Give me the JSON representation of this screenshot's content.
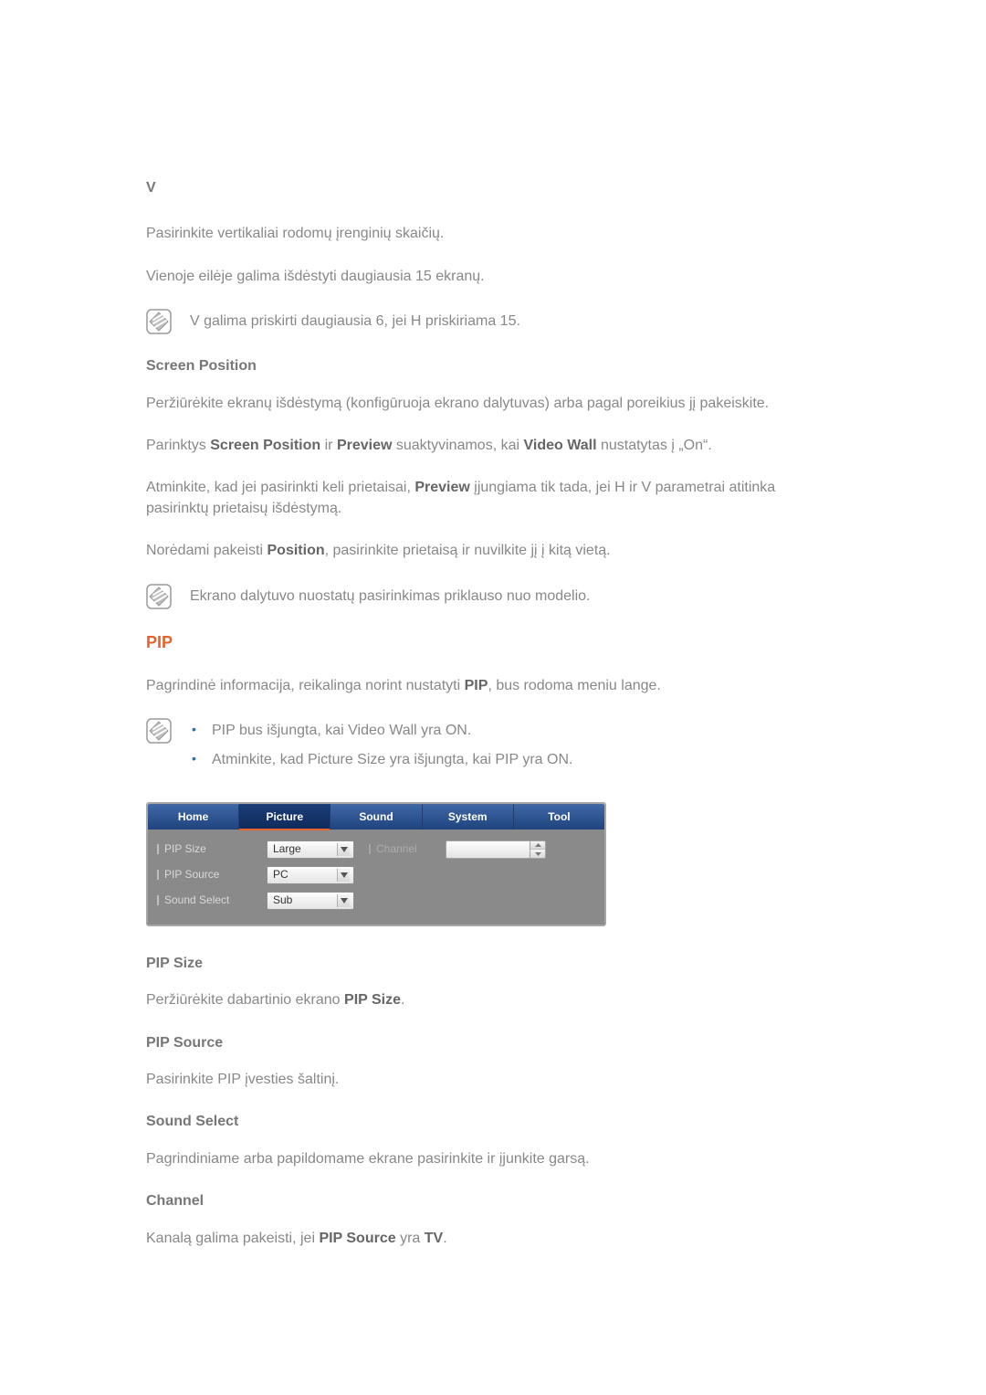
{
  "section_v": {
    "title": "V",
    "p1": "Pasirinkite vertikaliai rodomų įrenginių skaičių.",
    "p2": "Vienoje eilėje galima išdėstyti daugiausia 15 ekranų.",
    "note": "V galima priskirti daugiausia 6, jei H priskiriama 15."
  },
  "screen_position": {
    "title": "Screen Position",
    "p1_pre": "Peržiūrėkite ekranų išdėstymą (konfigūruoja ekrano dalytuvas) arba pagal poreikius jį pakeiskite.",
    "p2_pre": "Parinktys ",
    "p2_b1": "Screen Position",
    "p2_mid1": " ir ",
    "p2_b2": "Preview",
    "p2_mid2": " suaktyvinamos, kai ",
    "p2_b3": "Video Wall",
    "p2_post": " nustatytas į „On“.",
    "p3_pre": "Atminkite, kad jei pasirinkti keli prietaisai, ",
    "p3_b1": "Preview",
    "p3_post": " įjungiama tik tada, jei H ir V parametrai atitinka pasirinktų prietaisų išdėstymą.",
    "p4_pre": "Norėdami pakeisti ",
    "p4_b1": "Position",
    "p4_post": ", pasirinkite prietaisą ir nuvilkite jį į kitą vietą.",
    "note": "Ekrano dalytuvo nuostatų pasirinkimas priklauso nuo modelio."
  },
  "pip": {
    "title": "PIP",
    "intro_pre": "Pagrindinė informacija, reikalinga norint nustatyti ",
    "intro_b": "PIP",
    "intro_post": ", bus rodoma meniu lange.",
    "bullet1_b1": "PIP",
    "bullet1_mid": " bus išjungta, kai ",
    "bullet1_b2": "Video Wall",
    "bullet1_mid2": " yra ",
    "bullet1_b3": "ON",
    "bullet1_post": ".",
    "bullet2_pre": "Atminkite, kad ",
    "bullet2_b1": "Picture Size",
    "bullet2_mid": " yra išjungta, kai ",
    "bullet2_b2": "PIP",
    "bullet2_mid2": " yra ",
    "bullet2_b3": "ON",
    "bullet2_post": "."
  },
  "panel": {
    "tabs": [
      "Home",
      "Picture",
      "Sound",
      "System",
      "Tool"
    ],
    "selected_index": 1,
    "rows": {
      "pip_size_label": "PIP Size",
      "pip_size_value": "Large",
      "pip_source_label": "PIP Source",
      "pip_source_value": "PC",
      "sound_select_label": "Sound Select",
      "sound_select_value": "Sub",
      "channel_label": "Channel"
    }
  },
  "pip_size": {
    "title": "PIP Size",
    "p_pre": "Peržiūrėkite dabartinio ekrano ",
    "p_b": "PIP Size",
    "p_post": "."
  },
  "pip_source": {
    "title": "PIP Source",
    "p": "Pasirinkite PIP įvesties šaltinį."
  },
  "sound_select": {
    "title": "Sound Select",
    "p": "Pagrindiniame arba papildomame ekrane pasirinkite ir įjunkite garsą."
  },
  "channel": {
    "title": "Channel",
    "p_pre": "Kanalą galima pakeisti, jei ",
    "p_b1": "PIP Source",
    "p_mid": " yra ",
    "p_b2": "TV",
    "p_post": "."
  }
}
